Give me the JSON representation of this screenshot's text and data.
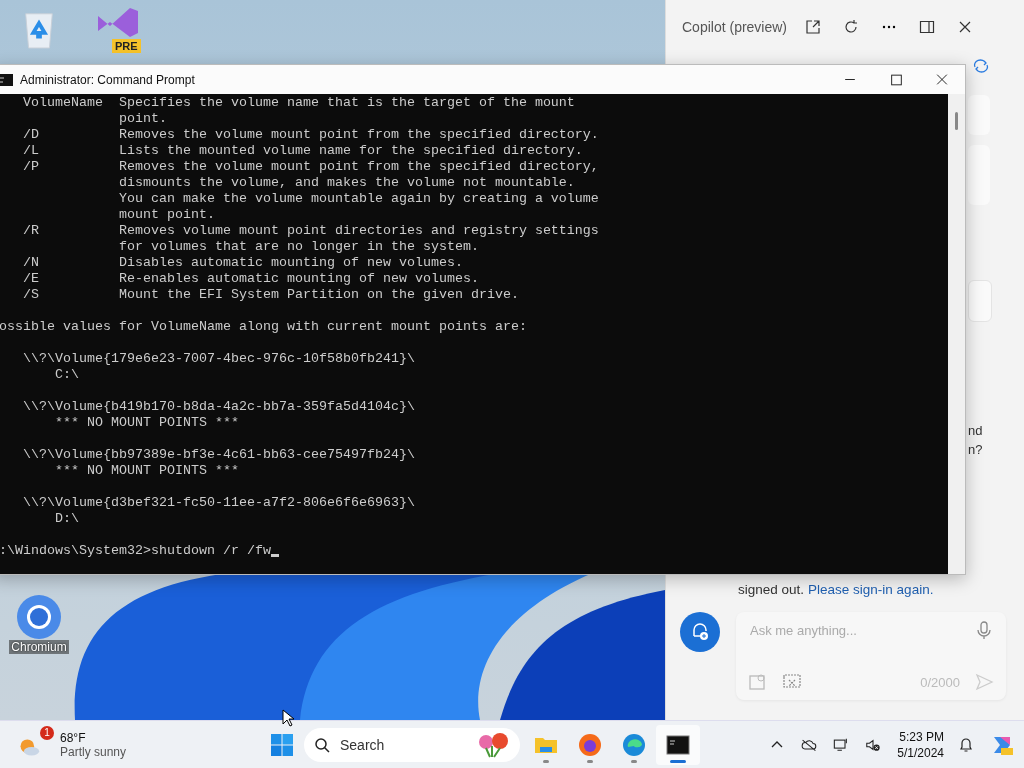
{
  "desktop_icons": [
    {
      "kind": "recycle"
    },
    {
      "kind": "studio",
      "badge": "PRE"
    },
    {
      "kind": "chromium",
      "label": "Chromium"
    }
  ],
  "console_window": {
    "title": "Administrator: Command Prompt",
    "blocks": [
      [
        "   VolumeName  Specifies the volume name that is the target of the mount",
        "               point.",
        "   /D          Removes the volume mount point from the specified directory.",
        "   /L          Lists the mounted volume name for the specified directory.",
        "   /P          Removes the volume mount point from the specified directory,",
        "               dismounts the volume, and makes the volume not mountable.",
        "               You can make the volume mountable again by creating a volume",
        "               mount point.",
        "   /R          Removes volume mount point directories and registry settings",
        "               for volumes that are no longer in the system.",
        "   /N          Disables automatic mounting of new volumes.",
        "   /E          Re-enables automatic mounting of new volumes.",
        "   /S          Mount the EFI System Partition on the given drive."
      ],
      [
        "ossible values for VolumeName along with current mount points are:"
      ],
      [
        "   \\\\?\\Volume{179e6e23-7007-4bec-976c-10f58b0fb241}\\",
        "       C:\\"
      ],
      [
        "   \\\\?\\Volume{b419b170-b8da-4a2c-bb7a-359fa5d4104c}\\",
        "       *** NO MOUNT POINTS ***"
      ],
      [
        "   \\\\?\\Volume{bb97389e-bf3e-4c61-bb63-cee75497fb24}\\",
        "       *** NO MOUNT POINTS ***"
      ],
      [
        "   \\\\?\\Volume{d3bef321-fc50-11ee-a7f2-806e6f6e6963}\\",
        "       D:\\"
      ]
    ],
    "prompt": ":\\Windows\\System32>",
    "command": "shutdown /r /fw"
  },
  "copilot": {
    "title": "Copilot (preview)",
    "fragments": [
      "nd",
      "n?"
    ],
    "notice_2": "signed out.",
    "link": "Please sign-in again.",
    "placeholder": "Ask me anything...",
    "counter": "0/2000"
  },
  "taskbar": {
    "weather": {
      "badge": "1",
      "temp": "68°F",
      "condition": "Partly sunny"
    },
    "search": "Search",
    "apps": [
      {
        "kind": "folder",
        "selected": false
      },
      {
        "kind": "firefox",
        "selected": false
      },
      {
        "kind": "edge",
        "selected": false
      },
      {
        "kind": "terminal",
        "selected": true
      }
    ],
    "time": "5:23 PM",
    "date": "5/1/2024"
  }
}
